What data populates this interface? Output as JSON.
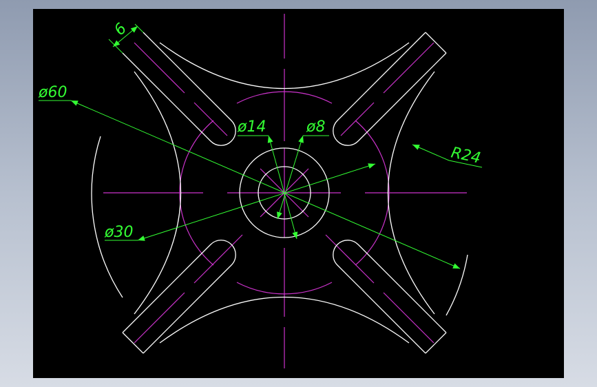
{
  "colors": {
    "background": "#000000",
    "geometry": "#ffffff",
    "centerline": "#cc33cc",
    "dimension": "#33ff33",
    "frame": "#a7b1c2"
  },
  "dimensions": {
    "slot_width": "6",
    "outer_diameter": "ø60",
    "bore_diameter": "ø14",
    "hole_diameter": "ø8",
    "pitch_diameter": "ø30",
    "arc_radius": "R24"
  }
}
